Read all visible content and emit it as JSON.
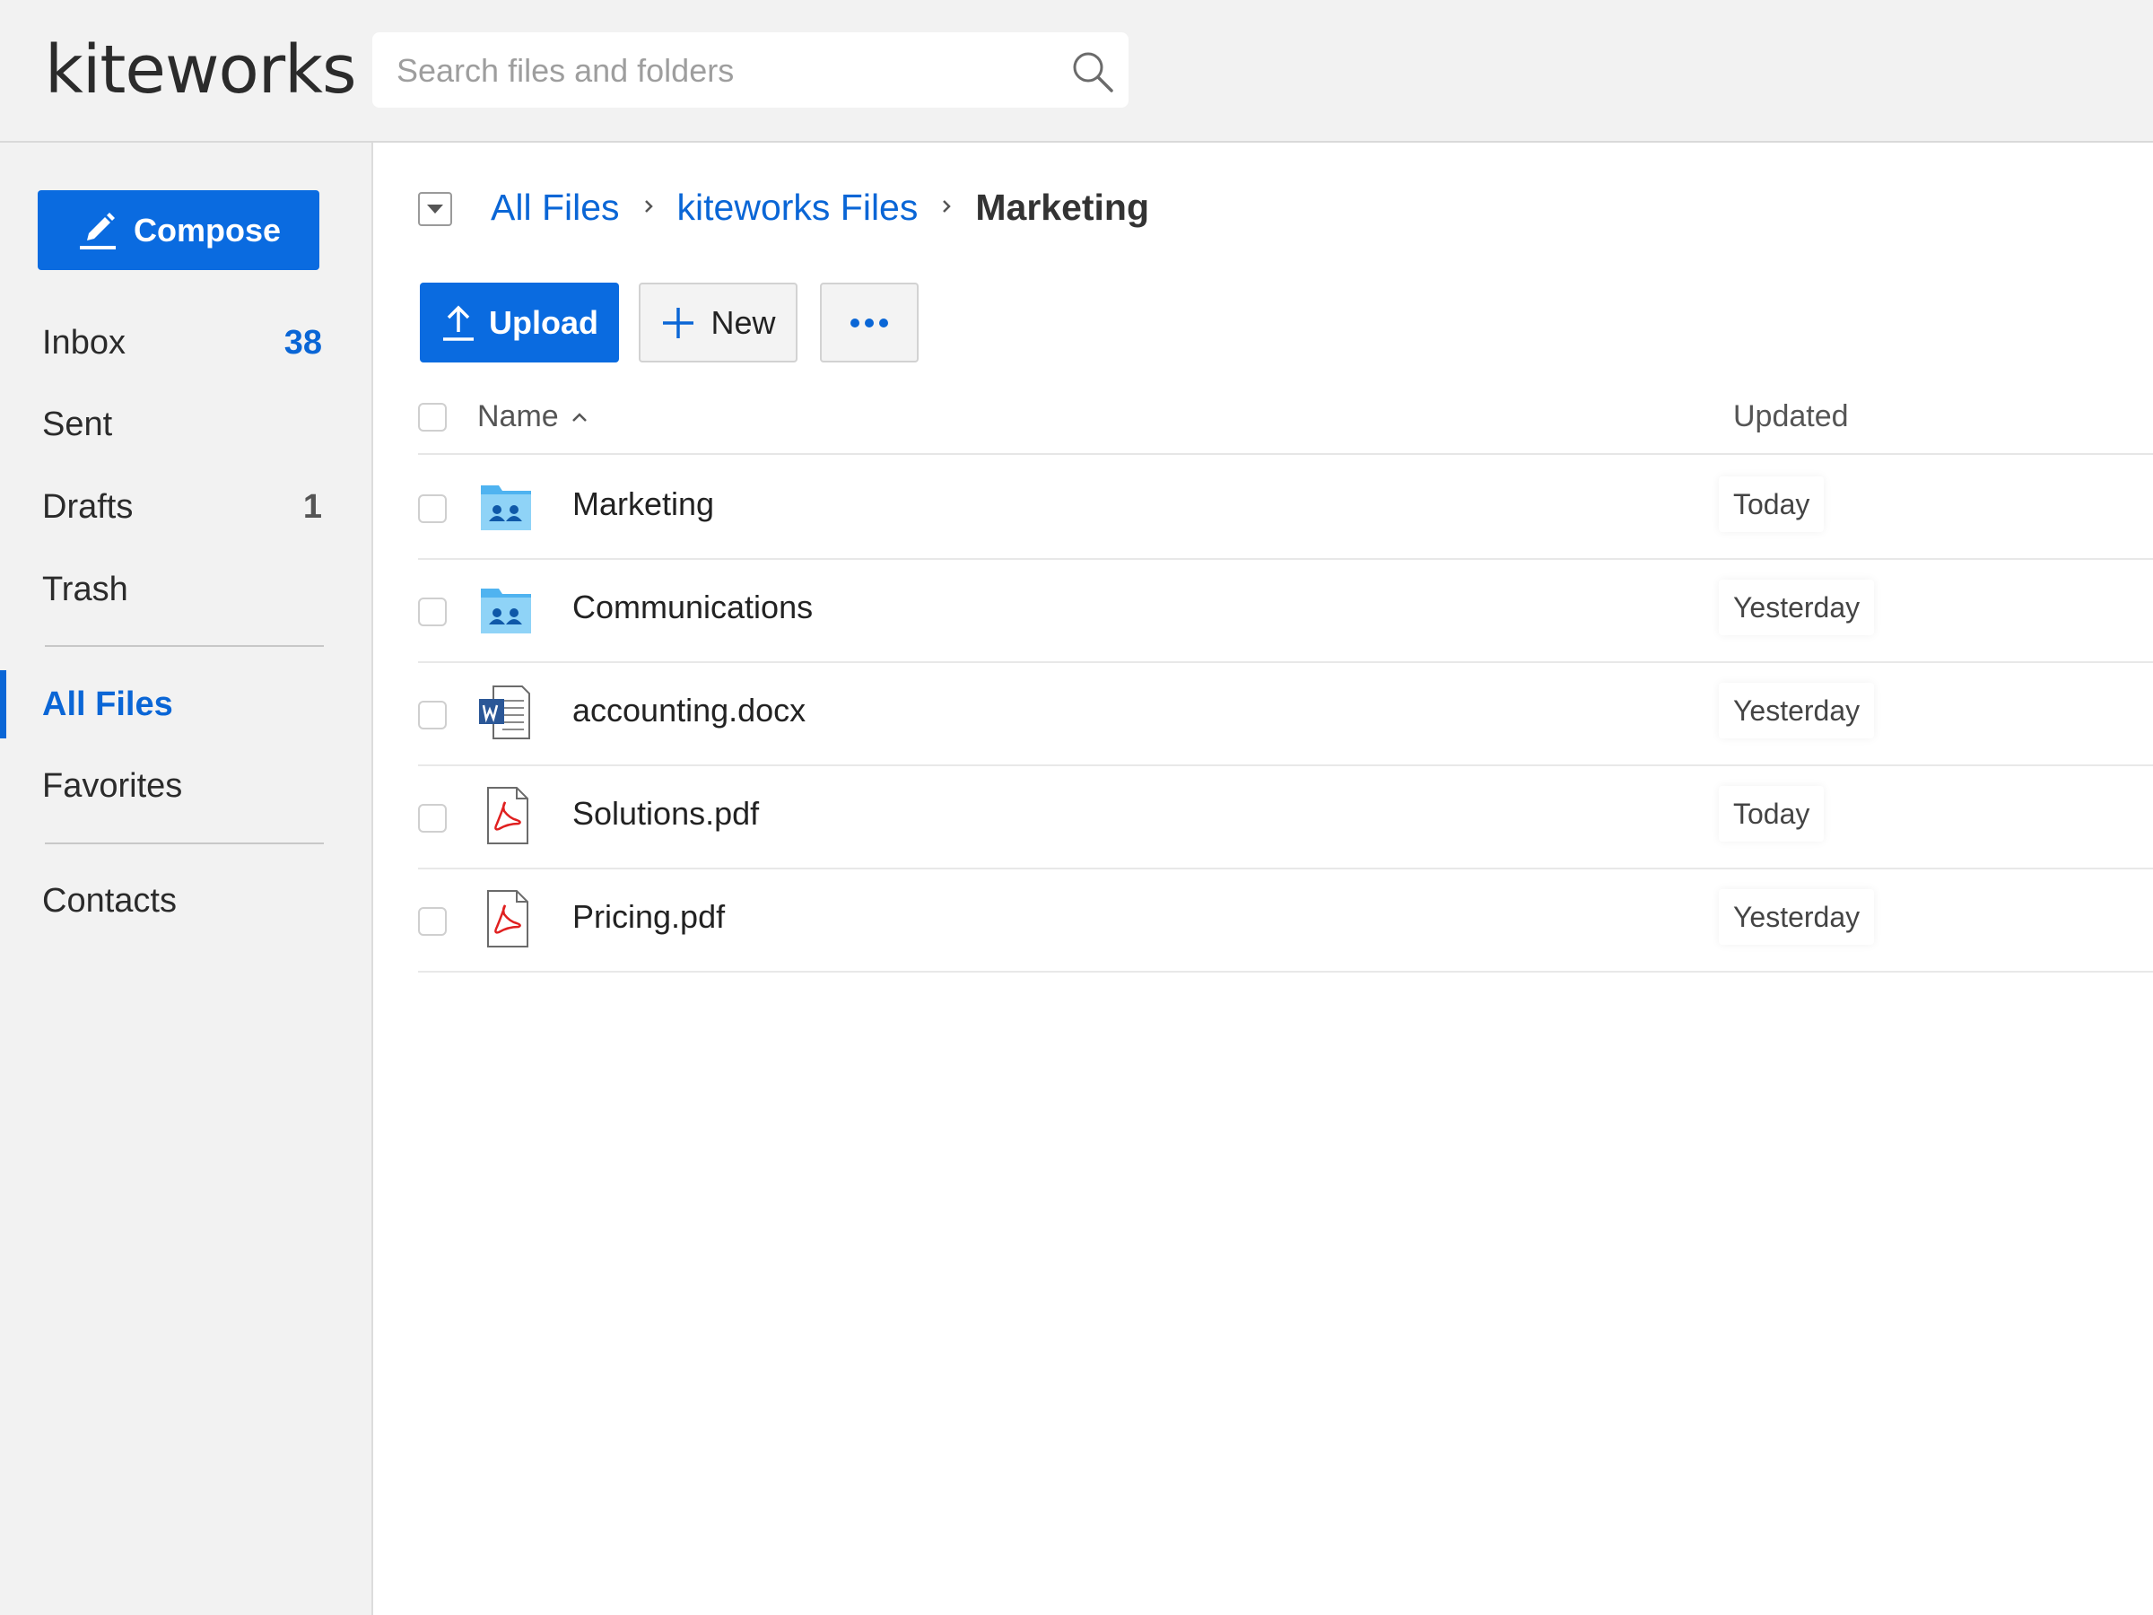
{
  "app": {
    "logo": "kiteworks"
  },
  "search": {
    "placeholder": "Search files and folders"
  },
  "sidebar": {
    "compose_label": "Compose",
    "items": [
      {
        "label": "Inbox",
        "count": "38",
        "count_color": "#0a66d6"
      },
      {
        "label": "Sent",
        "count": ""
      },
      {
        "label": "Drafts",
        "count": "1",
        "count_color": "#555555"
      },
      {
        "label": "Trash",
        "count": ""
      },
      {
        "label": "All Files",
        "count": "",
        "active": true
      },
      {
        "label": "Favorites",
        "count": ""
      },
      {
        "label": "Contacts",
        "count": ""
      }
    ]
  },
  "breadcrumb": {
    "items": [
      "All Files",
      "kiteworks Files"
    ],
    "current": "Marketing"
  },
  "toolbar": {
    "upload_label": "Upload",
    "new_label": "New",
    "more_icon": "more-dots-icon"
  },
  "table": {
    "columns": {
      "name": "Name",
      "updated": "Updated"
    },
    "sort": {
      "column": "Name",
      "direction": "ascending"
    },
    "rows": [
      {
        "name": "Marketing",
        "updated": "Today",
        "icon": "shared-folder-icon"
      },
      {
        "name": "Communications",
        "updated": "Yesterday",
        "icon": "shared-folder-icon"
      },
      {
        "name": "accounting.docx",
        "updated": "Yesterday",
        "icon": "word-document-icon"
      },
      {
        "name": "Solutions.pdf",
        "updated": "Today",
        "icon": "pdf-file-icon"
      },
      {
        "name": "Pricing.pdf",
        "updated": "Yesterday",
        "icon": "pdf-file-icon"
      }
    ]
  },
  "colors": {
    "accent": "#0a6be0",
    "link": "#0a66d6",
    "sidebar_bg": "#f2f2f2"
  }
}
